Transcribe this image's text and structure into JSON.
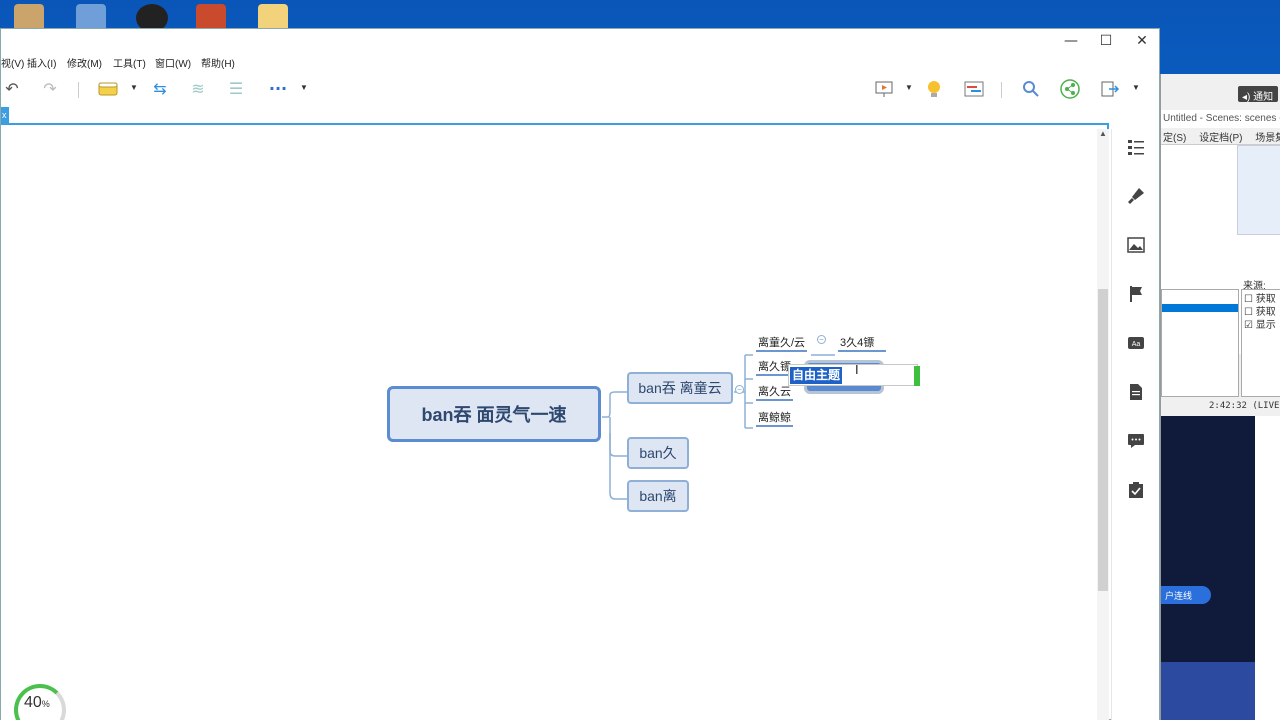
{
  "app": {
    "menu": [
      "视(V)",
      "插入(I)",
      "修改(M)",
      "工具(T)",
      "窗口(W)",
      "帮助(H)"
    ],
    "window_controls": {
      "minimize": "—",
      "maximize": "☐",
      "close": "✕"
    },
    "tab_label": "x"
  },
  "mindmap": {
    "central": "ban吞 面灵气一速",
    "topics": [
      {
        "label": "ban吞 离童云"
      },
      {
        "label": "ban久"
      },
      {
        "label": "ban离"
      }
    ],
    "subtopics": [
      "离童久/云",
      "离久镖",
      "离久云",
      "离鲸鲸"
    ],
    "side_label": "3久4镖",
    "editing_text": "自由主题"
  },
  "zoom": {
    "value": "40",
    "unit": "%"
  },
  "background_app": {
    "notify": "◂) 通知",
    "title": "Untitled - Scenes: scenes -",
    "menu": [
      "定(S)",
      "设定档(P)",
      "场景集合"
    ],
    "sources_label": "来源:",
    "sources": [
      "☐ 获取",
      "☐ 获取",
      "☑ 显示"
    ],
    "status_time": "2:42:32 (LIVE",
    "pill_label": "户连线"
  },
  "colors": {
    "accent": "#3a9ee0",
    "node_fill": "#dde6f2",
    "node_border": "#8eafd6",
    "central_border": "#5b8bd0",
    "selection": "#1e62c8"
  }
}
